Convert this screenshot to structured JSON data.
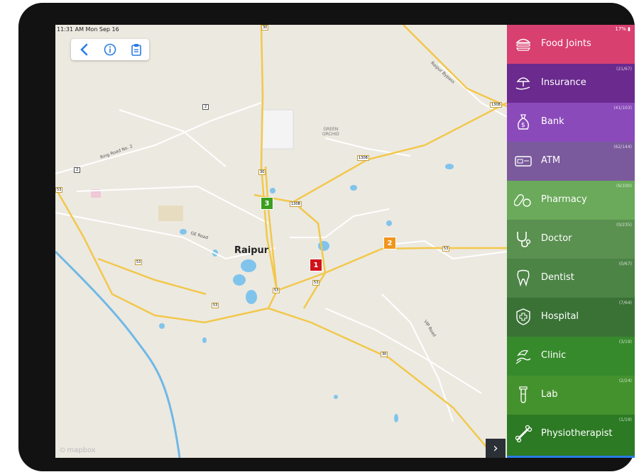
{
  "status": {
    "time": "11:31 AM  Mon Sep 16",
    "battery": "17% ▮"
  },
  "toolbar": {
    "back_icon": "chevron-left-icon",
    "info_icon": "info-icon",
    "clipboard_icon": "clipboard-icon"
  },
  "map": {
    "city": "Raipur",
    "labels": {
      "green_orchid": "GREEN\nORCHID",
      "ring_road": "Ring Road No. 2",
      "ge_road": "GE Road",
      "raipur_bypass": "Raipur Bypass",
      "vip_road": "VIP Road"
    },
    "shields": [
      "30",
      "2",
      "130B",
      "130B",
      "130B",
      "30",
      "53",
      "53",
      "53",
      "53",
      "53",
      "53",
      "30",
      "2"
    ],
    "markers": [
      {
        "label": "1",
        "color": "#d0121b"
      },
      {
        "label": "2",
        "color": "#f0961e"
      },
      {
        "label": "3",
        "color": "#3a9e1e"
      }
    ],
    "watermark": "mapbox"
  },
  "categories": [
    {
      "label": "Food Joints",
      "count": "",
      "color": "#d8406f",
      "icon": "burger-icon"
    },
    {
      "label": "Insurance",
      "count": "(21/67)",
      "color": "#6a2a8e",
      "icon": "umbrella-hand-icon"
    },
    {
      "label": "Bank",
      "count": "(41/103)",
      "color": "#8a4aba",
      "icon": "money-bag-icon"
    },
    {
      "label": "ATM",
      "count": "(62/144)",
      "color": "#7a5a9c",
      "icon": "atm-card-icon"
    },
    {
      "label": "Pharmacy",
      "count": "(6/100)",
      "color": "#6aaa5a",
      "icon": "pills-icon"
    },
    {
      "label": "Doctor",
      "count": "(0/235)",
      "color": "#5a9050",
      "icon": "stethoscope-icon"
    },
    {
      "label": "Dentist",
      "count": "(0/67)",
      "color": "#4c8446",
      "icon": "tooth-icon"
    },
    {
      "label": "Hospital",
      "count": "(7/64)",
      "color": "#3a7236",
      "icon": "hospital-cross-icon"
    },
    {
      "label": "Clinic",
      "count": "(3/19)",
      "color": "#378a2c",
      "icon": "clinic-icon"
    },
    {
      "label": "Lab",
      "count": "(2/24)",
      "color": "#44922e",
      "icon": "test-tube-icon"
    },
    {
      "label": "Physiotherapist",
      "count": "(1/19)",
      "color": "#2c7a24",
      "icon": "bone-icon"
    }
  ],
  "expand_label": "›"
}
